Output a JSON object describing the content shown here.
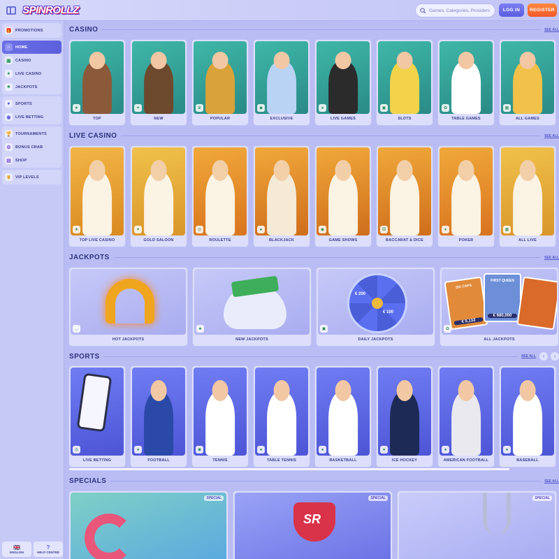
{
  "header": {
    "logo": "SPINROLLZ",
    "search_placeholder": "Games, Categories, Providers",
    "login_label": "LOG IN",
    "register_label": "REGISTER"
  },
  "sidebar": {
    "groups": [
      [
        {
          "label": "PROMOTIONS",
          "icon": "gift-icon"
        }
      ],
      [
        {
          "label": "HOME",
          "icon": "home-icon",
          "active": true
        },
        {
          "label": "CASINO",
          "icon": "slot-machine-icon"
        },
        {
          "label": "LIVE CASINO",
          "icon": "live-cards-icon"
        },
        {
          "label": "JACKPOTS",
          "icon": "clover-icon"
        }
      ],
      [
        {
          "label": "SPORTS",
          "icon": "ball-icon"
        },
        {
          "label": "LIVE BETTING",
          "icon": "live-ball-icon"
        }
      ],
      [
        {
          "label": "TOURNAMENTS",
          "icon": "trophy-icon"
        },
        {
          "label": "BONUS CRAB",
          "icon": "claw-icon"
        },
        {
          "label": "SHOP",
          "icon": "shop-icon"
        }
      ],
      [
        {
          "label": "VIP LEVELS",
          "icon": "crown-icon"
        }
      ]
    ],
    "language_label": "ENGLISH",
    "help_label": "HELP CENTRE"
  },
  "sections": {
    "casino": {
      "title": "CASINO",
      "see_all": "SEE ALL",
      "cards": [
        "TOP",
        "NEW",
        "POPULAR",
        "EXCLUSIVE",
        "LIVE GAMES",
        "SLOTS",
        "TABLE GAMES",
        "ALL GAMES"
      ]
    },
    "live_casino": {
      "title": "LIVE CASINO",
      "see_all": "SEE ALL",
      "cards": [
        "TOP LIVE CASINO",
        "GOLD SALOON",
        "ROULETTE",
        "BLACKJACK",
        "GAME SHOWS",
        "BACCARAT & DICE",
        "POKER",
        "ALL LIVE"
      ]
    },
    "jackpots": {
      "title": "JACKPOTS",
      "see_all": "SEE ALL",
      "cards": [
        "HOT JACKPOTS",
        "NEW JACKPOTS",
        "DAILY JACKPOTS",
        "ALL JACKPOTS"
      ],
      "thumb_text": {
        "game_a": "SIX CAPS",
        "game_b": "FIRST QUEEN",
        "amount_a": "€ 5,132",
        "amount_b": "€ 680,000",
        "wheel_a": "€ 200",
        "wheel_b": "€ 100"
      }
    },
    "sports": {
      "title": "SPORTS",
      "see_all": "SEE ALL",
      "cards": [
        "LIVE BETTING",
        "FOOTBALL",
        "TENNIS",
        "TABLE TENNIS",
        "BASKETBALL",
        "ICE HOCKEY",
        "AMERICAN FOOTBALL",
        "BASEBALL"
      ]
    },
    "specials": {
      "title": "SPECIALS",
      "see_all": "SEE ALL",
      "tag": "SPECIAL",
      "trophy_text": "SR"
    }
  },
  "colors": {
    "page_bg": "#b9bdf4",
    "accent": "#5b5fdc",
    "register": "#f2572b"
  }
}
